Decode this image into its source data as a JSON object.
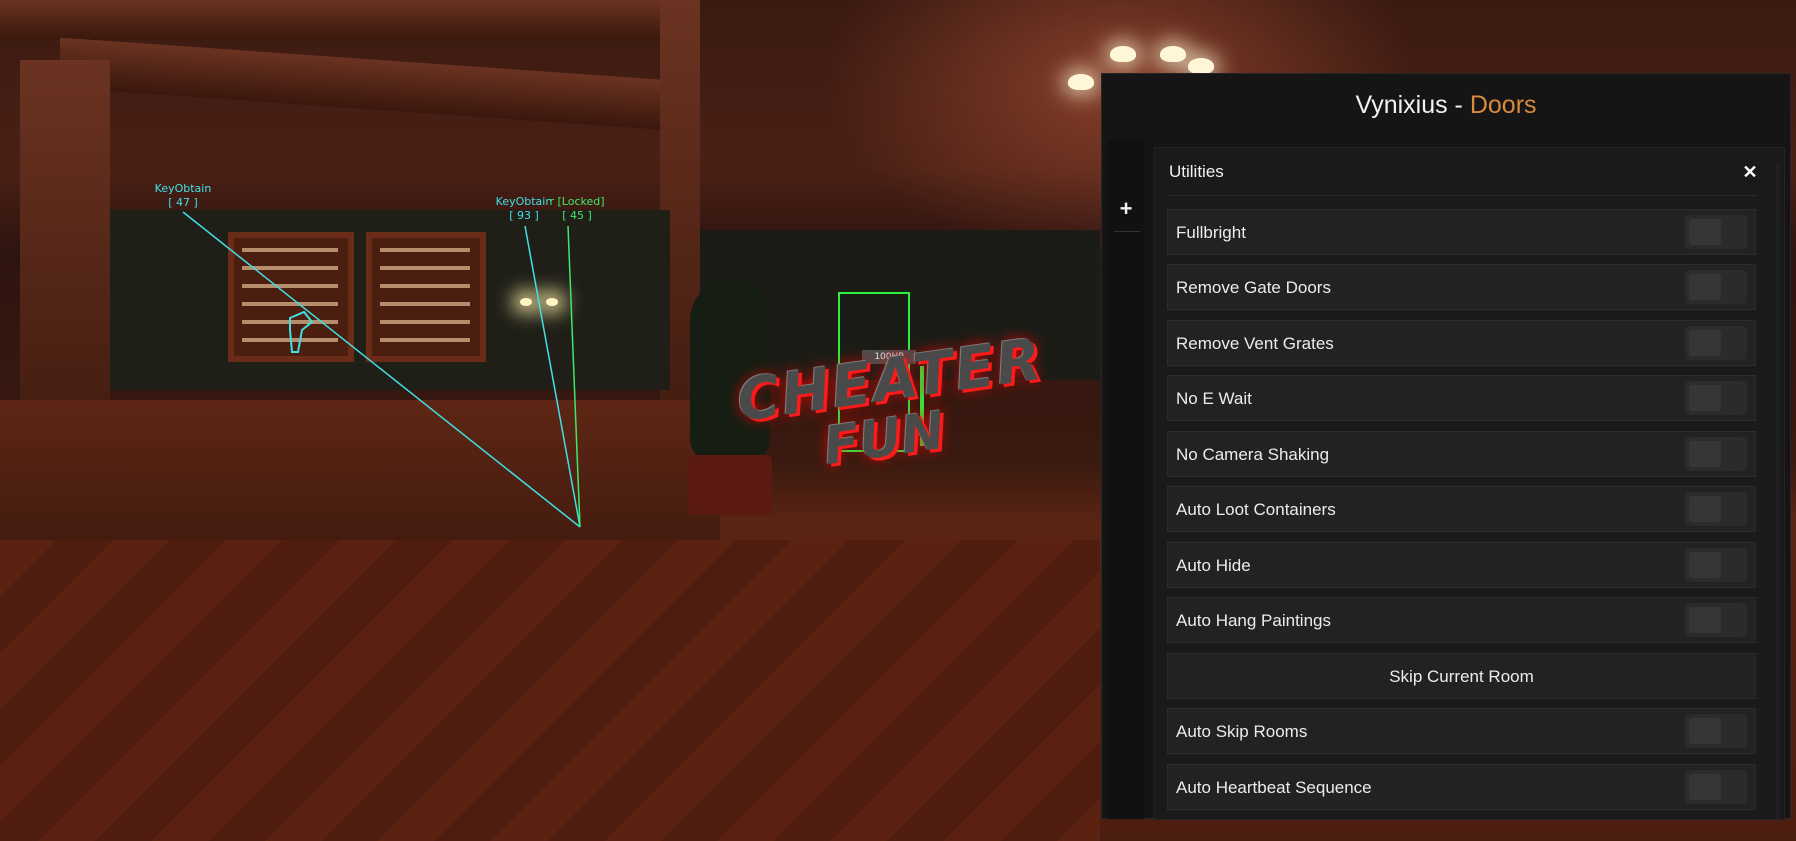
{
  "scene": {
    "esp_labels": [
      {
        "name": "KeyObtain",
        "dist": "[ 47 ]",
        "color": "#3fe0e6"
      },
      {
        "name": "KeyObtain",
        "dist": "[ 93 ]",
        "color": "#3fe0e6"
      },
      {
        "name": "r [Locked]",
        "dist": "[ 45 ]",
        "color": "#3ee86a"
      }
    ],
    "hp_label": "100HP",
    "watermark": {
      "line1": "CHEATER",
      "line2": "FUN"
    }
  },
  "hub": {
    "title_main": "Vynixius - ",
    "title_accent": "Doors",
    "accent_color": "#d98a3c",
    "add_icon": "plus-icon",
    "section": {
      "title": "Utilities",
      "close_icon": "close-icon",
      "items": [
        {
          "label": "Fullbright",
          "type": "toggle",
          "on": false
        },
        {
          "label": "Remove Gate Doors",
          "type": "toggle",
          "on": false
        },
        {
          "label": "Remove Vent Grates",
          "type": "toggle",
          "on": false
        },
        {
          "label": "No E Wait",
          "type": "toggle",
          "on": false
        },
        {
          "label": "No Camera Shaking",
          "type": "toggle",
          "on": false
        },
        {
          "label": "Auto Loot Containers",
          "type": "toggle",
          "on": false
        },
        {
          "label": "Auto Hide",
          "type": "toggle",
          "on": false
        },
        {
          "label": "Auto Hang Paintings",
          "type": "toggle",
          "on": false
        },
        {
          "label": "Skip Current Room",
          "type": "button"
        },
        {
          "label": "Auto Skip Rooms",
          "type": "toggle",
          "on": false
        },
        {
          "label": "Auto Heartbeat Sequence",
          "type": "toggle",
          "on": false
        }
      ]
    }
  }
}
